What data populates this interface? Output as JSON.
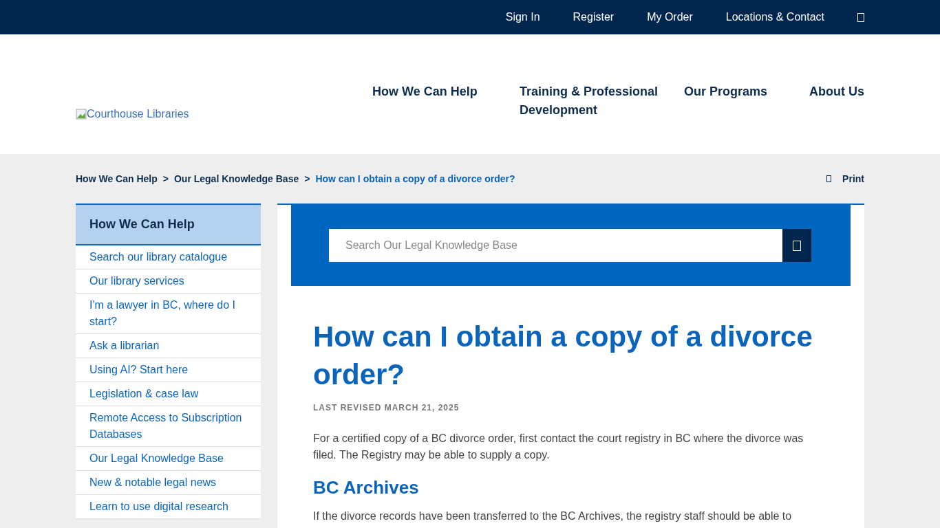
{
  "top_bar": {
    "links": [
      "Sign In",
      "Register",
      "My Order",
      "Locations & Contact"
    ]
  },
  "logo": {
    "alt": "Courthouse Libraries"
  },
  "main_nav": [
    "How We Can Help",
    "Training & Professional Development",
    "Our Programs",
    "About Us"
  ],
  "breadcrumb": {
    "items": [
      "How We Can Help",
      "Our Legal Knowledge Base",
      "How can I obtain a copy of a divorce order?"
    ],
    "separator": ">",
    "print": "Print"
  },
  "sidebar": {
    "title": "How We Can Help",
    "items": [
      "Search our library catalogue",
      "Our library services",
      "I'm a lawyer in BC, where do I start?",
      "Ask a librarian",
      "Using AI? Start here",
      "Legislation & case law",
      "Remote Access to Subscription Databases",
      "Our Legal Knowledge Base",
      "New & notable legal news",
      "Learn to use digital research"
    ]
  },
  "search": {
    "placeholder": "Search Our Legal Knowledge Base"
  },
  "article": {
    "title": "How can I obtain a copy of a divorce order?",
    "revised": "LAST REVISED MARCH 21, 2025",
    "blocks": [
      {
        "kind": "paragraph",
        "text": "For a certified copy of a BC divorce order, first contact the court registry in BC where the divorce was filed. The Registry may be able to supply a copy."
      },
      {
        "kind": "heading",
        "text": "BC Archives"
      },
      {
        "kind": "paragraph",
        "text": "If the divorce records have been transferred to the BC Archives, the registry staff should be able to"
      }
    ]
  }
}
